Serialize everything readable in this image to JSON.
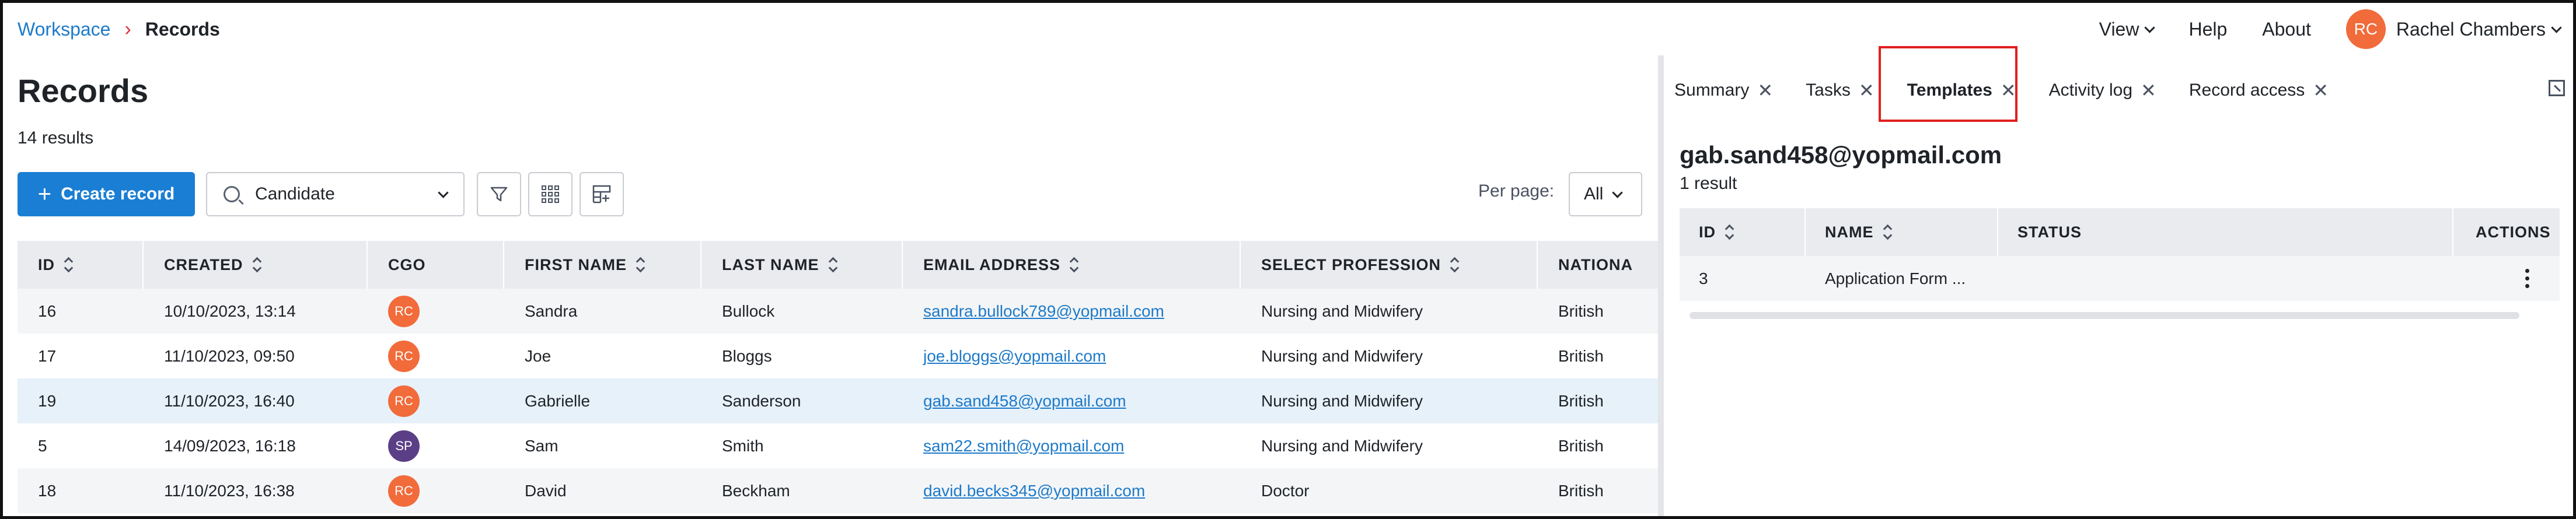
{
  "breadcrumb": {
    "root": "Workspace",
    "current": "Records"
  },
  "topnav": {
    "view": "View",
    "help": "Help",
    "about": "About",
    "user_initials": "RC",
    "user_name": "Rachel Chambers"
  },
  "records": {
    "title": "Records",
    "results": "14 results",
    "create_label": "Create record",
    "filter_value": "Candidate",
    "per_page_label": "Per page:",
    "per_page_value": "All",
    "columns": [
      "ID",
      "CREATED",
      "CGO",
      "FIRST NAME",
      "LAST NAME",
      "EMAIL ADDRESS",
      "SELECT PROFESSION",
      "NATIONA"
    ],
    "rows": [
      {
        "id": "16",
        "created": "10/10/2023, 13:14",
        "cgo": "RC",
        "first": "Sandra",
        "last": "Bullock",
        "email": "sandra.bullock789@yopmail.com",
        "profession": "Nursing and Midwifery",
        "nationality": "British"
      },
      {
        "id": "17",
        "created": "11/10/2023, 09:50",
        "cgo": "RC",
        "first": "Joe",
        "last": "Bloggs",
        "email": "joe.bloggs@yopmail.com",
        "profession": "Nursing and Midwifery",
        "nationality": "British"
      },
      {
        "id": "19",
        "created": "11/10/2023, 16:40",
        "cgo": "RC",
        "first": "Gabrielle",
        "last": "Sanderson",
        "email": "gab.sand458@yopmail.com",
        "profession": "Nursing and Midwifery",
        "nationality": "British"
      },
      {
        "id": "5",
        "created": "14/09/2023, 16:18",
        "cgo": "SP",
        "first": "Sam",
        "last": "Smith",
        "email": "sam22.smith@yopmail.com",
        "profession": "Nursing and Midwifery",
        "nationality": "British"
      },
      {
        "id": "18",
        "created": "11/10/2023, 16:38",
        "cgo": "RC",
        "first": "David",
        "last": "Beckham",
        "email": "david.becks345@yopmail.com",
        "profession": "Doctor",
        "nationality": "British"
      }
    ]
  },
  "panel": {
    "tabs": [
      "Summary",
      "Tasks",
      "Templates",
      "Activity log",
      "Record access"
    ],
    "active_tab": "Templates",
    "email": "gab.sand458@yopmail.com",
    "result": "1 result",
    "columns": [
      "ID",
      "NAME",
      "STATUS",
      "ACTIONS"
    ],
    "rows": [
      {
        "id": "3",
        "name": "Application Form ...",
        "status": ""
      }
    ]
  },
  "colors": {
    "primary": "#1a7fd4",
    "link": "#1d7ac9",
    "avatar_rc": "#f26b3a",
    "avatar_sp": "#5b3f86",
    "highlight": "#e0201f"
  }
}
